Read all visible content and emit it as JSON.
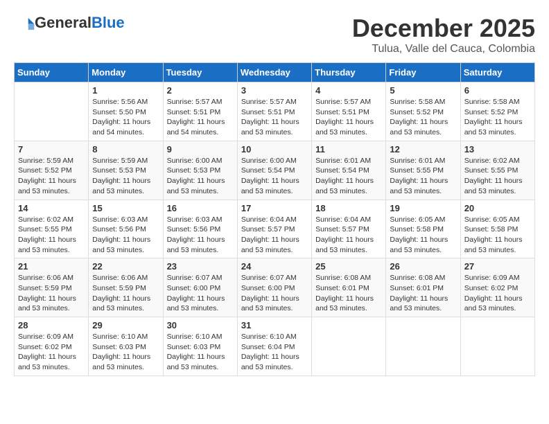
{
  "logo": {
    "general": "General",
    "blue": "Blue"
  },
  "header": {
    "month": "December 2025",
    "location": "Tulua, Valle del Cauca, Colombia"
  },
  "weekdays": [
    "Sunday",
    "Monday",
    "Tuesday",
    "Wednesday",
    "Thursday",
    "Friday",
    "Saturday"
  ],
  "weeks": [
    [
      {
        "day": "",
        "info": ""
      },
      {
        "day": "1",
        "info": "Sunrise: 5:56 AM\nSunset: 5:50 PM\nDaylight: 11 hours\nand 54 minutes."
      },
      {
        "day": "2",
        "info": "Sunrise: 5:57 AM\nSunset: 5:51 PM\nDaylight: 11 hours\nand 54 minutes."
      },
      {
        "day": "3",
        "info": "Sunrise: 5:57 AM\nSunset: 5:51 PM\nDaylight: 11 hours\nand 53 minutes."
      },
      {
        "day": "4",
        "info": "Sunrise: 5:57 AM\nSunset: 5:51 PM\nDaylight: 11 hours\nand 53 minutes."
      },
      {
        "day": "5",
        "info": "Sunrise: 5:58 AM\nSunset: 5:52 PM\nDaylight: 11 hours\nand 53 minutes."
      },
      {
        "day": "6",
        "info": "Sunrise: 5:58 AM\nSunset: 5:52 PM\nDaylight: 11 hours\nand 53 minutes."
      }
    ],
    [
      {
        "day": "7",
        "info": "Sunrise: 5:59 AM\nSunset: 5:52 PM\nDaylight: 11 hours\nand 53 minutes."
      },
      {
        "day": "8",
        "info": "Sunrise: 5:59 AM\nSunset: 5:53 PM\nDaylight: 11 hours\nand 53 minutes."
      },
      {
        "day": "9",
        "info": "Sunrise: 6:00 AM\nSunset: 5:53 PM\nDaylight: 11 hours\nand 53 minutes."
      },
      {
        "day": "10",
        "info": "Sunrise: 6:00 AM\nSunset: 5:54 PM\nDaylight: 11 hours\nand 53 minutes."
      },
      {
        "day": "11",
        "info": "Sunrise: 6:01 AM\nSunset: 5:54 PM\nDaylight: 11 hours\nand 53 minutes."
      },
      {
        "day": "12",
        "info": "Sunrise: 6:01 AM\nSunset: 5:55 PM\nDaylight: 11 hours\nand 53 minutes."
      },
      {
        "day": "13",
        "info": "Sunrise: 6:02 AM\nSunset: 5:55 PM\nDaylight: 11 hours\nand 53 minutes."
      }
    ],
    [
      {
        "day": "14",
        "info": "Sunrise: 6:02 AM\nSunset: 5:55 PM\nDaylight: 11 hours\nand 53 minutes."
      },
      {
        "day": "15",
        "info": "Sunrise: 6:03 AM\nSunset: 5:56 PM\nDaylight: 11 hours\nand 53 minutes."
      },
      {
        "day": "16",
        "info": "Sunrise: 6:03 AM\nSunset: 5:56 PM\nDaylight: 11 hours\nand 53 minutes."
      },
      {
        "day": "17",
        "info": "Sunrise: 6:04 AM\nSunset: 5:57 PM\nDaylight: 11 hours\nand 53 minutes."
      },
      {
        "day": "18",
        "info": "Sunrise: 6:04 AM\nSunset: 5:57 PM\nDaylight: 11 hours\nand 53 minutes."
      },
      {
        "day": "19",
        "info": "Sunrise: 6:05 AM\nSunset: 5:58 PM\nDaylight: 11 hours\nand 53 minutes."
      },
      {
        "day": "20",
        "info": "Sunrise: 6:05 AM\nSunset: 5:58 PM\nDaylight: 11 hours\nand 53 minutes."
      }
    ],
    [
      {
        "day": "21",
        "info": "Sunrise: 6:06 AM\nSunset: 5:59 PM\nDaylight: 11 hours\nand 53 minutes."
      },
      {
        "day": "22",
        "info": "Sunrise: 6:06 AM\nSunset: 5:59 PM\nDaylight: 11 hours\nand 53 minutes."
      },
      {
        "day": "23",
        "info": "Sunrise: 6:07 AM\nSunset: 6:00 PM\nDaylight: 11 hours\nand 53 minutes."
      },
      {
        "day": "24",
        "info": "Sunrise: 6:07 AM\nSunset: 6:00 PM\nDaylight: 11 hours\nand 53 minutes."
      },
      {
        "day": "25",
        "info": "Sunrise: 6:08 AM\nSunset: 6:01 PM\nDaylight: 11 hours\nand 53 minutes."
      },
      {
        "day": "26",
        "info": "Sunrise: 6:08 AM\nSunset: 6:01 PM\nDaylight: 11 hours\nand 53 minutes."
      },
      {
        "day": "27",
        "info": "Sunrise: 6:09 AM\nSunset: 6:02 PM\nDaylight: 11 hours\nand 53 minutes."
      }
    ],
    [
      {
        "day": "28",
        "info": "Sunrise: 6:09 AM\nSunset: 6:02 PM\nDaylight: 11 hours\nand 53 minutes."
      },
      {
        "day": "29",
        "info": "Sunrise: 6:10 AM\nSunset: 6:03 PM\nDaylight: 11 hours\nand 53 minutes."
      },
      {
        "day": "30",
        "info": "Sunrise: 6:10 AM\nSunset: 6:03 PM\nDaylight: 11 hours\nand 53 minutes."
      },
      {
        "day": "31",
        "info": "Sunrise: 6:10 AM\nSunset: 6:04 PM\nDaylight: 11 hours\nand 53 minutes."
      },
      {
        "day": "",
        "info": ""
      },
      {
        "day": "",
        "info": ""
      },
      {
        "day": "",
        "info": ""
      }
    ]
  ]
}
